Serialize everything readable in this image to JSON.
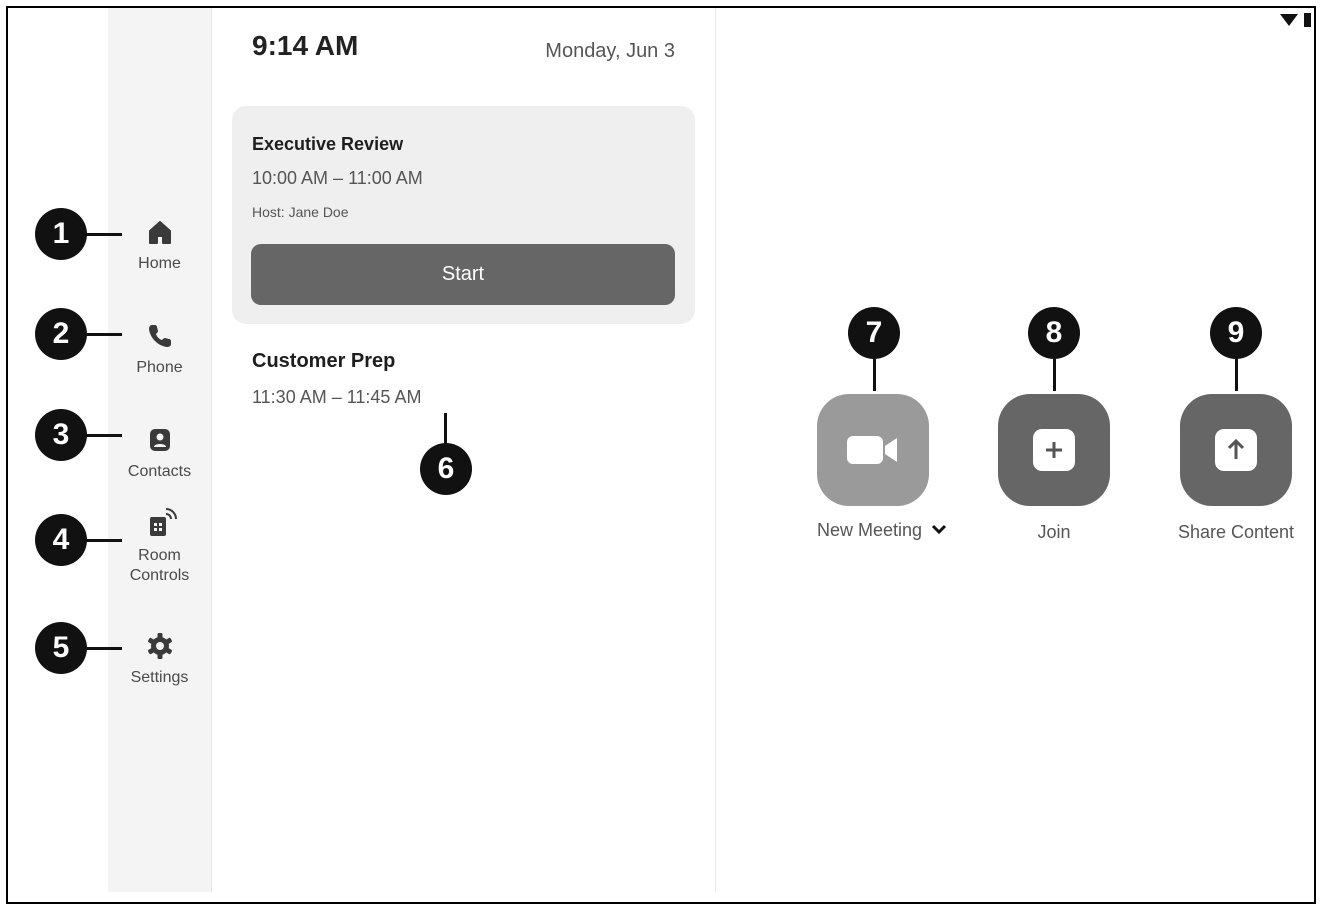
{
  "header": {
    "time": "9:14 AM",
    "date": "Monday, Jun 3"
  },
  "sidebar": {
    "items": [
      {
        "label": "Home",
        "icon": "home-icon"
      },
      {
        "label": "Phone",
        "icon": "phone-icon"
      },
      {
        "label": "Contacts",
        "icon": "contacts-icon"
      },
      {
        "label": "Room Controls",
        "icon": "room-controls-icon"
      },
      {
        "label": "Settings",
        "icon": "gear-icon"
      }
    ]
  },
  "meetings": [
    {
      "title": "Executive Review",
      "time": "10:00 AM – 11:00 AM",
      "host": "Host: Jane Doe",
      "button": "Start"
    },
    {
      "title": "Customer Prep",
      "time": "11:30 AM – 11:45 AM"
    }
  ],
  "actions": [
    {
      "label": "New Meeting",
      "icon": "video-camera-icon",
      "color": "#9a9a9a"
    },
    {
      "label": "Join",
      "icon": "plus-icon",
      "color": "#666666"
    },
    {
      "label": "Share Content",
      "icon": "share-up-arrow-icon",
      "color": "#666666"
    }
  ],
  "callouts": [
    "1",
    "2",
    "3",
    "4",
    "5",
    "6",
    "7",
    "8",
    "9"
  ]
}
